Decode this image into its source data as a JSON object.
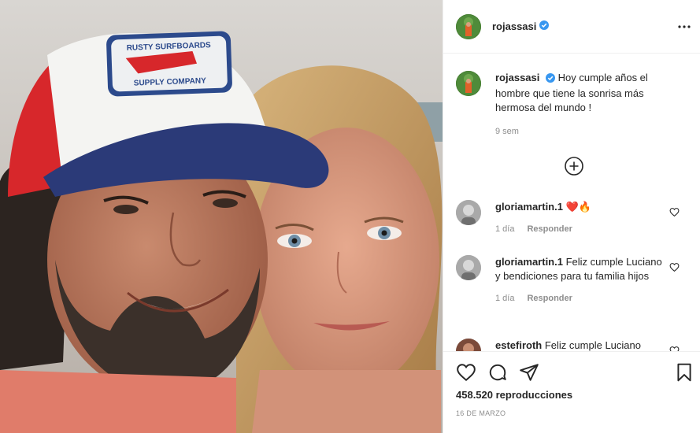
{
  "post": {
    "media_alt": "Selfie of a smiling couple; the man wears a red, white and blue trucker cap",
    "cap_patch_line1": "RUSTY SURFBOARDS",
    "cap_patch_line2": "SUPPLY COMPANY"
  },
  "header": {
    "username": "rojassasi",
    "more_icon": "more-horizontal-icon"
  },
  "caption": {
    "username": "rojassasi",
    "text": "Hoy cumple años el hombre que tiene la sonrisa más hermosa del mundo !",
    "time": "9 sem"
  },
  "comments": [
    {
      "username": "gloriamartin.1",
      "text": "❤️🔥",
      "time": "1 día",
      "reply": "Responder"
    },
    {
      "username": "gloriamartin.1",
      "text": "Feliz cumple Luciano y bendiciones para tu familia hijos",
      "time": "1 día",
      "reply": "Responder"
    },
    {
      "username": "estefiroth",
      "text": "Feliz cumple Luciano",
      "time": "",
      "reply": ""
    }
  ],
  "actions": {
    "views": "458.520 reproducciones",
    "date": "16 DE MARZO"
  },
  "colors": {
    "verified": "#3897f0",
    "meta": "#8e8e8e",
    "text": "#262626"
  }
}
